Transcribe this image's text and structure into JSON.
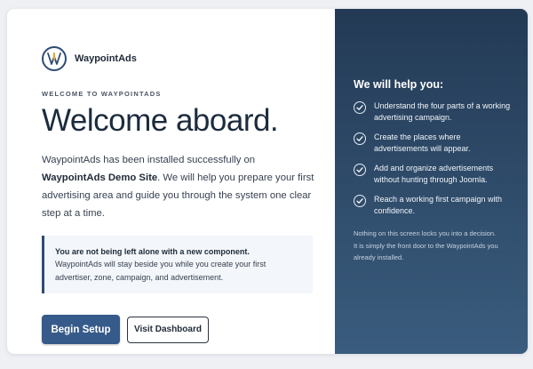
{
  "brand": {
    "name": "WaypointAds",
    "logo_icon": "waypoint-logo-icon"
  },
  "welcome": {
    "eyebrow": "WELCOME TO WAYPOINTADS",
    "headline": "Welcome aboard.",
    "intro_before": "WaypointAds has been installed successfully on ",
    "intro_site": "WaypointAds Demo Site",
    "intro_after": ". We will help you prepare your first advertising area and guide you through the system one clear step at a time."
  },
  "callout": {
    "title": "You are not being left alone with a new component.",
    "body": "WaypointAds will stay beside you while you create your first advertiser, zone, campaign, and advertisement."
  },
  "actions": {
    "begin_label": "Begin Setup",
    "dashboard_label": "Visit Dashboard"
  },
  "help": {
    "title": "We will help you:",
    "items": [
      "Understand the four parts of a working advertising campaign.",
      "Create the places where advertisements will appear.",
      "Add and organize advertisements without hunting through Joomla.",
      "Reach a working first campaign with confidence."
    ],
    "footnote": "Nothing on this screen locks you into a decision. It is simply the front door to the WaypointAds you already installed."
  },
  "colors": {
    "accent": "#365a8a",
    "panel_top": "#233a55",
    "panel_bottom": "#3a5c7e",
    "logo_gold": "#e8a317"
  }
}
